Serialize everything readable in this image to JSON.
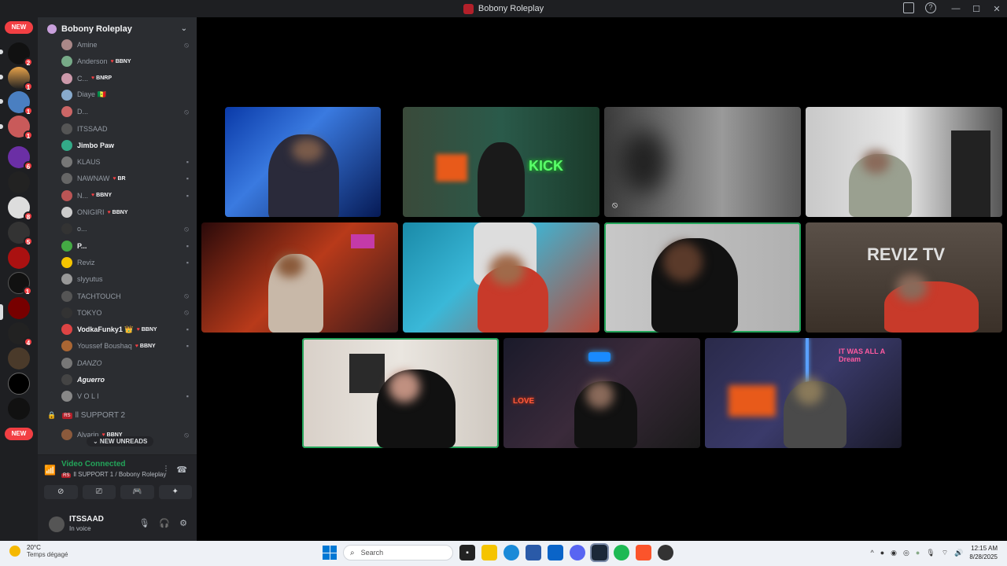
{
  "window": {
    "title": "Bobony Roleplay"
  },
  "server_rail": {
    "new_top": "NEW",
    "new_bottom": "NEW",
    "badges": [
      "2",
      "1",
      "1",
      "1",
      "6",
      "8",
      "5",
      "1",
      "4"
    ]
  },
  "server": {
    "name": "Bobony Roleplay"
  },
  "members": [
    {
      "name": "Amine",
      "tag": "",
      "style": ""
    },
    {
      "name": "Anderson",
      "tag": "BBNY",
      "style": ""
    },
    {
      "name": "C...",
      "tag": "BNRP",
      "style": ""
    },
    {
      "name": "Diaye 🇸🇳",
      "tag": "",
      "style": ""
    },
    {
      "name": "D...",
      "tag": "",
      "style": ""
    },
    {
      "name": "ITSSAAD",
      "tag": "",
      "style": ""
    },
    {
      "name": "Jimbo Paw",
      "tag": "",
      "style": "bold"
    },
    {
      "name": "KLAUS",
      "tag": "",
      "style": ""
    },
    {
      "name": "NAWNAW",
      "tag": "BR",
      "style": ""
    },
    {
      "name": "N...",
      "tag": "BBNY",
      "style": ""
    },
    {
      "name": "ONIGIRI",
      "tag": "BBNY",
      "style": ""
    },
    {
      "name": "o...",
      "tag": "",
      "style": ""
    },
    {
      "name": "P...",
      "tag": "",
      "style": "bold"
    },
    {
      "name": "Reviz",
      "tag": "",
      "style": ""
    },
    {
      "name": "slyyutus",
      "tag": "",
      "style": ""
    },
    {
      "name": "TACHTOUCH",
      "tag": "",
      "style": ""
    },
    {
      "name": "TOKYO",
      "tag": "",
      "style": ""
    },
    {
      "name": "VodkaFunky1 👑",
      "tag": "BBNY",
      "style": "bold"
    },
    {
      "name": "Youssef Boushaq",
      "tag": "BBNY",
      "style": ""
    },
    {
      "name": "DANZO",
      "tag": "",
      "style": "italic"
    },
    {
      "name": "Aguerro",
      "tag": "",
      "style": "bolditalic"
    },
    {
      "name": "V O L I",
      "tag": "",
      "style": ""
    }
  ],
  "category": {
    "prefix": "RS",
    "name": "ll SUPPORT 2"
  },
  "partial_member": {
    "name": "Alvarin",
    "tag": "BBNY"
  },
  "new_unreads": "⌄ NEW UNREADS",
  "voice": {
    "status": "Video Connected",
    "channel": "ll SUPPORT 1 / Bobony Roleplay",
    "prefix": "RS"
  },
  "user": {
    "name": "ITSSAAD",
    "status": "In voice"
  },
  "stream_overlays": {
    "kick_text": "KICK",
    "reviz_text": "REVIZ TV",
    "dream_text": "IT WAS ALL A Dream",
    "love_text": "LOVE"
  },
  "taskbar": {
    "temp": "20°C",
    "weather": "Temps dégagé",
    "search": "Search",
    "time": "12:15 AM",
    "date": "8/28/2025"
  }
}
